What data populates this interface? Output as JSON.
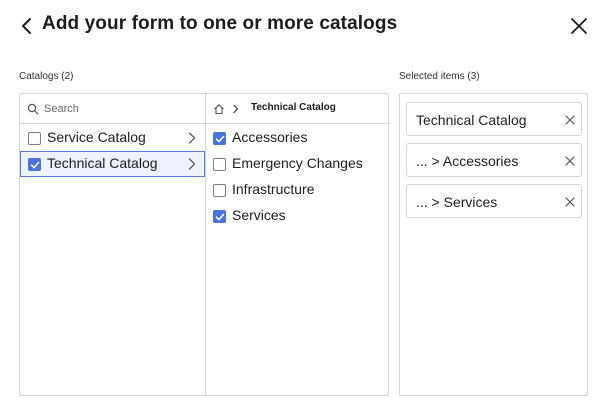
{
  "header": {
    "title": "Add your form to one or more catalogs",
    "back_icon": "chevron-left-icon",
    "close_icon": "close-icon"
  },
  "catalogs": {
    "label": "Catalogs (2)",
    "search": {
      "placeholder": "Search",
      "value": ""
    },
    "items": [
      {
        "label": "Service Catalog",
        "checked": false,
        "selected": false
      },
      {
        "label": "Technical Catalog",
        "checked": true,
        "selected": true
      }
    ]
  },
  "categories": {
    "breadcrumb": {
      "home_icon": "home-icon",
      "current": "Technical Catalog"
    },
    "items": [
      {
        "label": "Accessories",
        "checked": true
      },
      {
        "label": "Emergency Changes",
        "checked": false
      },
      {
        "label": "Infrastructure",
        "checked": false
      },
      {
        "label": "Services",
        "checked": true
      }
    ]
  },
  "selected_items": {
    "label": "Selected items (3)",
    "chips": [
      {
        "label": "Technical Catalog"
      },
      {
        "label": "... > Accessories"
      },
      {
        "label": "... > Services"
      }
    ]
  },
  "colors": {
    "accent": "#4a73e0",
    "selected_bg": "#eef2fd",
    "border": "#d6d6d6"
  }
}
